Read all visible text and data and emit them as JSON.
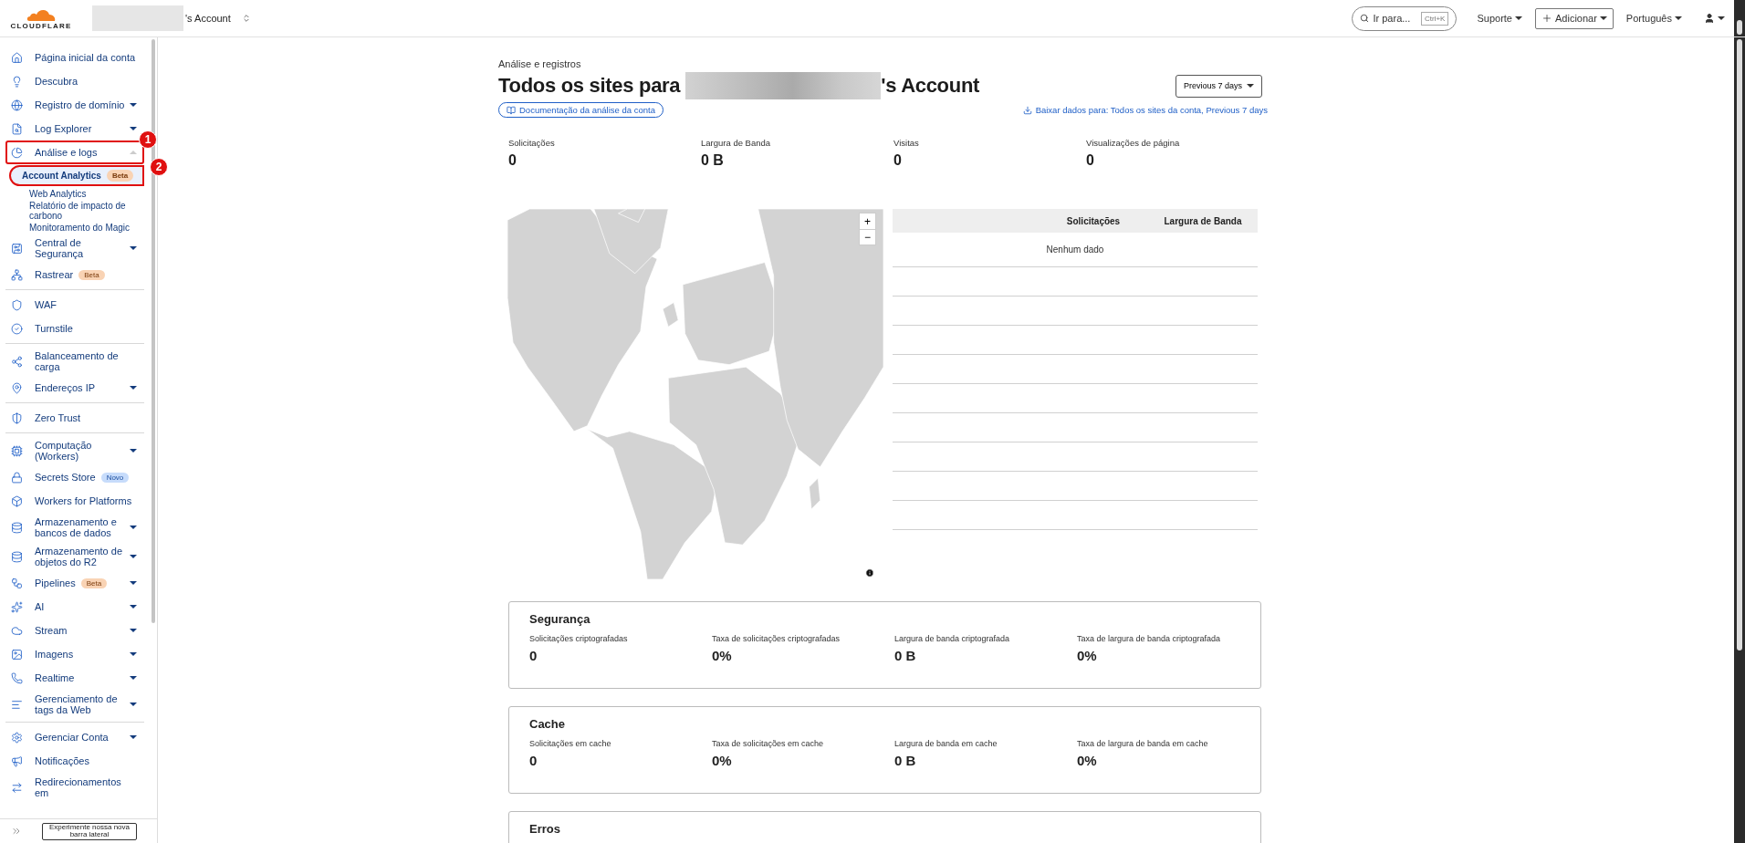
{
  "topbar": {
    "logo": "CLOUDFLARE",
    "account": "'s Account",
    "search": {
      "placeholder": "Ir para...",
      "shortcut": "Ctrl+K"
    },
    "menus": [
      {
        "label": "Suporte",
        "kind": "menu"
      },
      {
        "label": "Adicionar",
        "kind": "button"
      },
      {
        "label": "Português",
        "kind": "menu"
      }
    ]
  },
  "sidebar": {
    "sections": [
      {
        "items": [
          {
            "label": "Página inicial da conta",
            "kind": "link"
          },
          {
            "label": "Descubra",
            "kind": "link"
          },
          {
            "label": "Registro de domínio",
            "kind": "menu",
            "expanded": false
          },
          {
            "label": "Log Explorer",
            "kind": "menu",
            "expanded": false
          },
          {
            "label": "Análise e logs",
            "kind": "menu",
            "expanded": true,
            "callout": "1",
            "children": [
              {
                "label": "Account Analytics",
                "selected": true,
                "badge": {
                  "label": "Beta",
                  "kind": "beta"
                },
                "callout": "2"
              },
              {
                "label": "Web Analytics",
                "selected": false
              },
              {
                "label": "Relatório de impacto de carbono",
                "selected": false
              },
              {
                "label": "Monitoramento do Magic",
                "selected": false
              }
            ]
          },
          {
            "label": "Central de Segurança",
            "kind": "menu",
            "expanded": false
          },
          {
            "label": "Rastrear",
            "kind": "link",
            "badge": {
              "label": "Beta",
              "kind": "beta"
            }
          }
        ]
      },
      {
        "items": [
          {
            "label": "WAF",
            "kind": "link"
          },
          {
            "label": "Turnstile",
            "kind": "link"
          }
        ]
      },
      {
        "items": [
          {
            "label": "Balanceamento de carga",
            "kind": "link"
          },
          {
            "label": "Endereços IP",
            "kind": "menu",
            "expanded": false
          }
        ]
      },
      {
        "items": [
          {
            "label": "Zero Trust",
            "kind": "link"
          }
        ]
      },
      {
        "items": [
          {
            "label": "Computação (Workers)",
            "kind": "menu",
            "expanded": false
          },
          {
            "label": "Secrets Store",
            "kind": "link",
            "badge": {
              "label": "Novo",
              "kind": "new"
            }
          },
          {
            "label": "Workers for Platforms",
            "kind": "link"
          },
          {
            "label": "Armazenamento e bancos de dados",
            "kind": "menu",
            "expanded": false
          },
          {
            "label": "Armazenamento de objetos do R2",
            "kind": "menu",
            "expanded": false
          },
          {
            "label": "Pipelines",
            "kind": "menu",
            "expanded": false,
            "badge": {
              "label": "Beta",
              "kind": "beta"
            }
          },
          {
            "label": "AI",
            "kind": "menu",
            "expanded": false
          },
          {
            "label": "Stream",
            "kind": "menu",
            "expanded": false
          },
          {
            "label": "Imagens",
            "kind": "menu",
            "expanded": false
          },
          {
            "label": "Realtime",
            "kind": "menu",
            "expanded": false
          },
          {
            "label": "Gerenciamento de tags da Web",
            "kind": "menu",
            "expanded": false
          }
        ]
      },
      {
        "items": [
          {
            "label": "Gerenciar Conta",
            "kind": "menu",
            "expanded": false
          },
          {
            "label": "Notificações",
            "kind": "link"
          },
          {
            "label": "Redirecionamentos em",
            "kind": "link"
          }
        ]
      }
    ],
    "footer_button": "Experimente nossa nova barra lateral"
  },
  "main": {
    "breadcrumb": "Análise e registros",
    "title_prefix": "Todos os sites para",
    "title_suffix": "'s Account",
    "range": "Previous 7 days",
    "doc_link": "Documentação da análise da conta",
    "download_link": "Baixar dados para: Todos os sites da conta, Previous 7 days",
    "stats": [
      {
        "label": "Solicitações",
        "value": "0"
      },
      {
        "label": "Largura de Banda",
        "value": "0 B"
      },
      {
        "label": "Visitas",
        "value": "0"
      },
      {
        "label": "Visualizações de página",
        "value": "0"
      }
    ],
    "map": {
      "zoom_in": "+",
      "zoom_out": "−"
    },
    "table": {
      "columns": [
        "Solicitações",
        "Largura de Banda"
      ],
      "empty": "Nenhum dado"
    },
    "cards": [
      {
        "title": "Segurança",
        "metrics": [
          {
            "label": "Solicitações criptografadas",
            "value": "0"
          },
          {
            "label": "Taxa de solicitações criptografadas",
            "value": "0%"
          },
          {
            "label": "Largura de banda criptografada",
            "value": "0 B"
          },
          {
            "label": "Taxa de largura de banda criptografada",
            "value": "0%"
          }
        ]
      },
      {
        "title": "Cache",
        "metrics": [
          {
            "label": "Solicitações em cache",
            "value": "0"
          },
          {
            "label": "Taxa de solicitações em cache",
            "value": "0%"
          },
          {
            "label": "Largura de banda em cache",
            "value": "0 B"
          },
          {
            "label": "Taxa de largura de banda em cache",
            "value": "0%"
          }
        ]
      },
      {
        "title": "Erros"
      }
    ]
  }
}
